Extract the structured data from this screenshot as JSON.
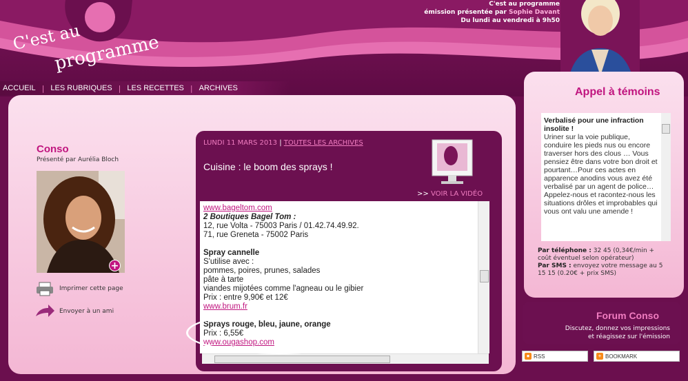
{
  "header": {
    "logo_line1": "C'est au",
    "logo_line2": "programme",
    "show_line1": "C'est au programme",
    "show_line2_prefix": "émission présentée par ",
    "show_line2_name": "Sophie Davant",
    "show_line3": "Du lundi au vendredi à 9h50"
  },
  "nav": {
    "items": [
      "ACCUEIL",
      "LES RUBRIQUES",
      "LES RECETTES",
      "ARCHIVES"
    ],
    "separator": "|"
  },
  "conso": {
    "title": "Conso",
    "presented_by": "Présenté par Aurélia Bloch",
    "print_label": "Imprimer cette page",
    "send_label": "Envoyer à un ami",
    "plus": "+"
  },
  "article": {
    "date": "LUNDI 11 MARS 2013",
    "date_sep": "|",
    "archives_link": "TOUTES LES ARCHIVES",
    "title": "Cuisine : le boom des sprays !",
    "video_prefix": ">>",
    "video_label": "VOIR LA VIDÉO",
    "body": {
      "link1": "www.bageltom.com",
      "shops": "2 Boutiques Bagel Tom :",
      "addr1": "12, rue Volta - 75003 Paris / 01.42.74.49.92.",
      "addr2": "71, rue Greneta - 75002 Paris",
      "spray1_title": "Spray cannelle",
      "spray1_l1": "S'utilise avec :",
      "spray1_l2": "pommes, poires, prunes, salades",
      "spray1_l3": "pâte à tarte",
      "spray1_l4": "viandes mijotées comme l'agneau ou le gibier",
      "spray1_price": "Prix : entre 9,90€ et 12€",
      "link2": "www.brum.fr",
      "spray2_title": "Sprays rouge, bleu, jaune, orange",
      "spray2_price": "Prix  : 6,55€",
      "link3": "www.ougashop.com"
    }
  },
  "appel": {
    "title": "Appel à témoins",
    "headline": "Verbalisé pour une infraction insolite !",
    "text": "Uriner sur la voie publique, conduire les pieds nus ou encore traverser hors des clous … Vous pensiez être dans votre bon droit et pourtant…Pour ces actes en apparence anodins vous avez été verbalisé par un agent de police…Appelez-nous et racontez-nous les situations drôles et improbables qui vous ont valu une amende !",
    "phone_label": "Par téléphone :",
    "phone_text": " 32 45 (0,34€/min + coût éventuel selon opérateur)",
    "sms_label": "Par SMS :",
    "sms_text": " envoyez votre message au 5 15 15 (0.20€ + prix SMS)"
  },
  "forum": {
    "title": "Forum Conso",
    "desc_line1": "Discutez, donnez vos impressions",
    "desc_line2": "et réagissez sur l'émission"
  },
  "badges": {
    "rss": "RSS",
    "bookmark": "BOOKMARK"
  },
  "colors": {
    "accent": "#c0157f",
    "dark_plum": "#6c1050",
    "panel_pink": "#fbe0ee"
  }
}
